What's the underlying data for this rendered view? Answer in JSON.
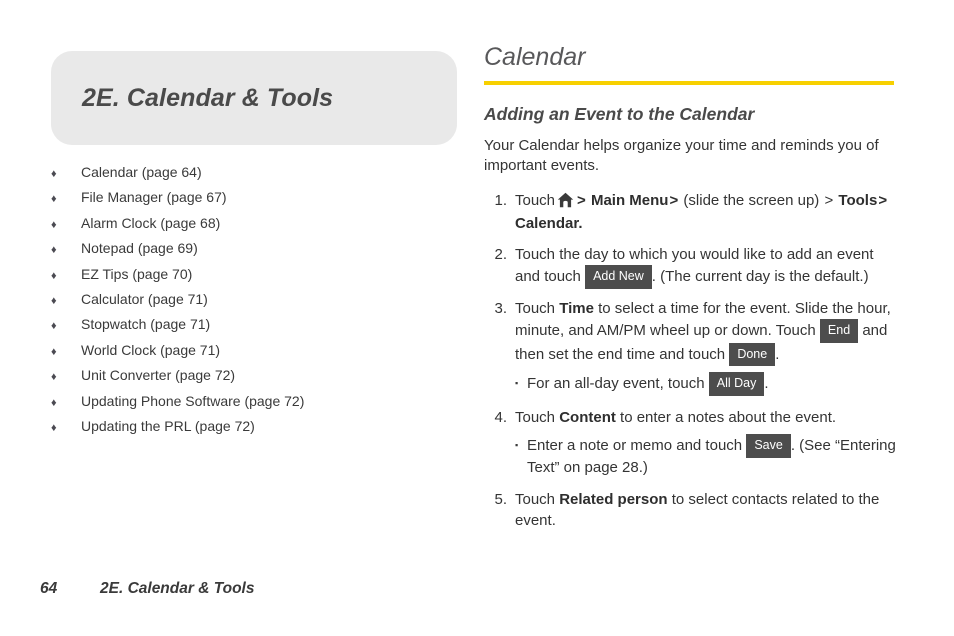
{
  "chapter": {
    "title": "2E.  Calendar & Tools"
  },
  "toc": {
    "bullet_glyph": "♦",
    "items": [
      {
        "label": "Calendar (page 64)"
      },
      {
        "label": "File Manager (page 67)"
      },
      {
        "label": "Alarm Clock (page 68)"
      },
      {
        "label": "Notepad (page 69)"
      },
      {
        "label": "EZ Tips (page 70)"
      },
      {
        "label": "Calculator (page 71)"
      },
      {
        "label": "Stopwatch (page 71)"
      },
      {
        "label": "World Clock (page 71)"
      },
      {
        "label": "Unit Converter (page 72)"
      },
      {
        "label": "Updating Phone Software (page 72)"
      },
      {
        "label": "Updating the PRL (page 72)"
      }
    ]
  },
  "section": {
    "title": "Calendar",
    "rule_color": "#f7d000",
    "subsection_title": "Adding an Event to the Calendar",
    "intro": "Your Calendar helps organize your time and reminds you of important events."
  },
  "steps": [
    {
      "num": "1.",
      "touch_label": "Touch",
      "home_icon": "home-icon",
      "sep1": ">",
      "main_menu": "Main Menu",
      "sep2": ">",
      "slide_text": "(slide the screen up)",
      "sep3": ">",
      "tools": "Tools",
      "sep4": ">",
      "calendar": "Calendar",
      "period": "."
    },
    {
      "num": "2.",
      "text_before": "Touch the day to which you would like to add an event and touch",
      "key": "Add New",
      "text_after": ". (The current day is the default.)"
    },
    {
      "num": "3.",
      "text_a": "Touch",
      "bold_time": "Time",
      "text_b": "to select a time for the event. Slide the hour, minute, and AM/PM wheel up or down. Touch",
      "key_end": "End",
      "text_c": "and then set the end time and touch",
      "key_done": "Done",
      "text_d": ".",
      "substeps": [
        {
          "bullet": "▪",
          "text_before": "For an all-day event, touch",
          "key": "All Day",
          "text_after": "."
        }
      ]
    },
    {
      "num": "4.",
      "text_a": "Touch",
      "bold_content": "Content",
      "text_b": "to enter a notes about the event.",
      "substeps": [
        {
          "bullet": "▪",
          "text_before": "Enter a note or memo and touch",
          "key": "Save",
          "text_after": ". (See “Entering Text” on page 28.)"
        }
      ]
    },
    {
      "num": "5.",
      "text_a": "Touch",
      "bold_related": "Related person",
      "text_b": "to select contacts related to the event."
    }
  ],
  "footer": {
    "page_number": "64",
    "chapter_label": "2E. Calendar & Tools"
  }
}
